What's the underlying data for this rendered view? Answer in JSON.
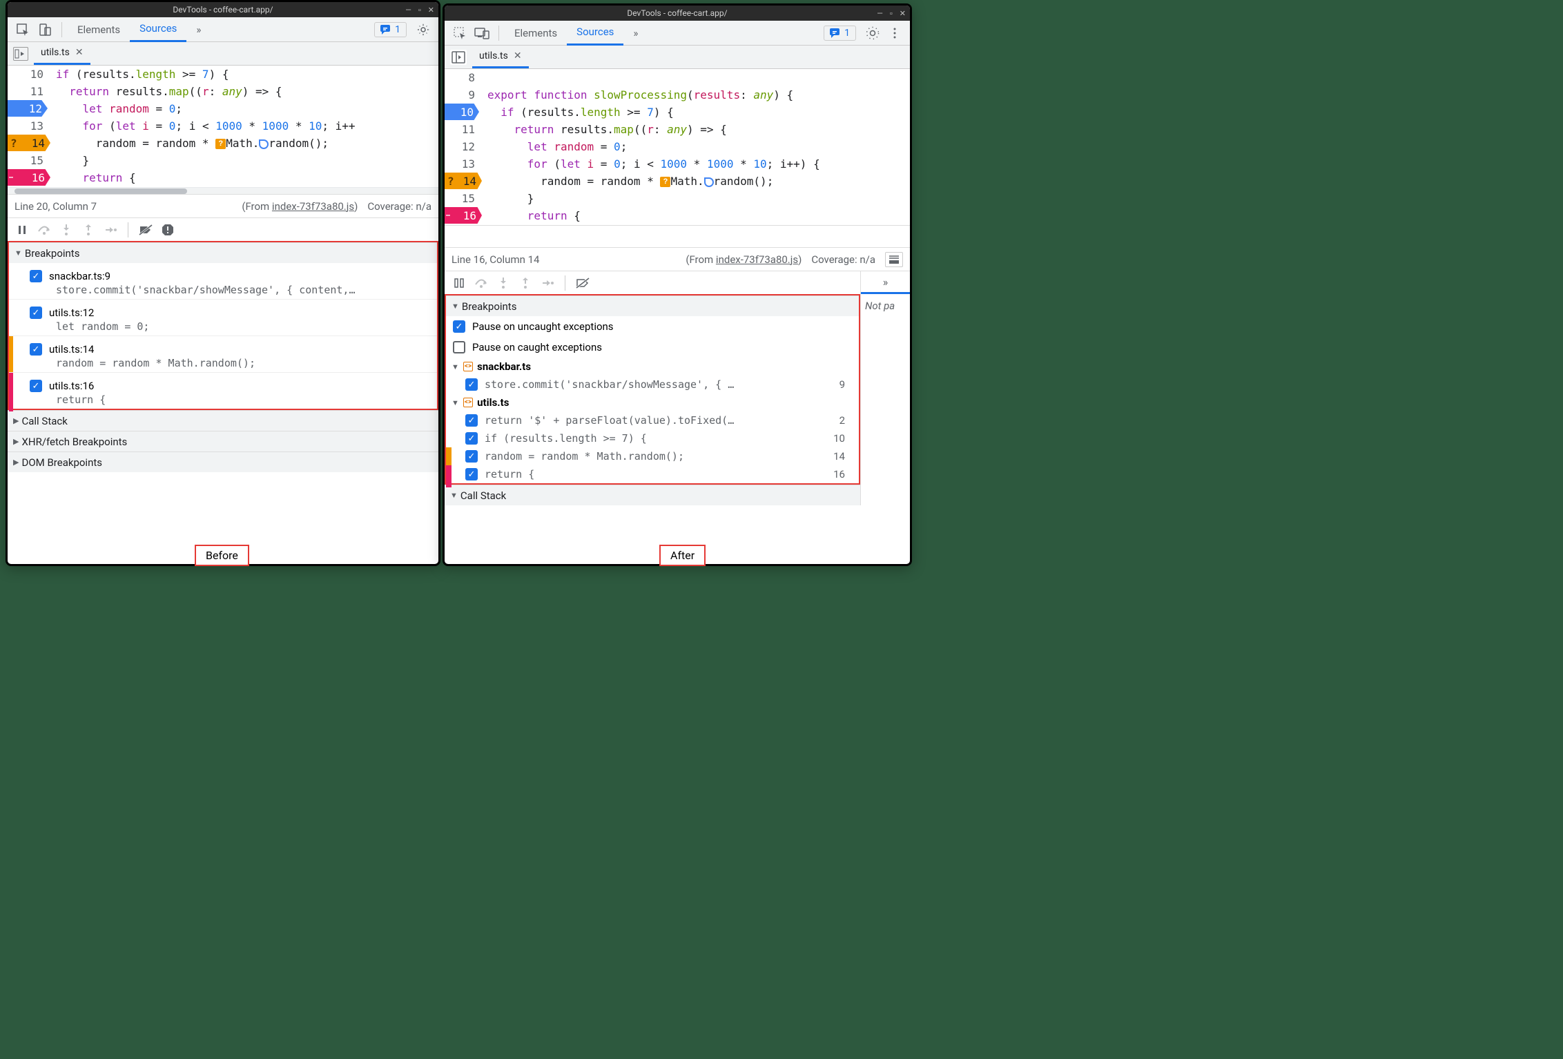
{
  "before": {
    "title": "DevTools - coffee-cart.app/",
    "tabs": {
      "elements": "Elements",
      "sources": "Sources",
      "more": "»"
    },
    "badge_count": "1",
    "file_tab": "utils.ts",
    "gutter": [
      "10",
      "11",
      "12",
      "13",
      "14",
      "15",
      "16"
    ],
    "status": {
      "pos": "Line 20, Column 7",
      "from_prefix": "(From ",
      "from_link": "index-73f73a80.js",
      "from_suffix": ")",
      "coverage": "Coverage: n/a"
    },
    "sections": {
      "breakpoints": "Breakpoints",
      "callstack": "Call Stack",
      "xhr": "XHR/fetch Breakpoints",
      "dom": "DOM Breakpoints"
    },
    "bp_items": [
      {
        "label": "snackbar.ts:9",
        "code": "store.commit('snackbar/showMessage', { content,…"
      },
      {
        "label": "utils.ts:12",
        "code": "let random = 0;"
      },
      {
        "label": "utils.ts:14",
        "code": "random = random * Math.random();"
      },
      {
        "label": "utils.ts:16",
        "code": "return {"
      }
    ]
  },
  "after": {
    "title": "DevTools - coffee-cart.app/",
    "tabs": {
      "elements": "Elements",
      "sources": "Sources",
      "more": "»"
    },
    "badge_count": "1",
    "file_tab": "utils.ts",
    "gutter": [
      "8",
      "9",
      "10",
      "11",
      "12",
      "13",
      "14",
      "15",
      "16"
    ],
    "status": {
      "pos": "Line 16, Column 14",
      "from_prefix": "(From ",
      "from_link": "index-73f73a80.js",
      "from_suffix": ")",
      "coverage": "Coverage: n/a"
    },
    "sections": {
      "breakpoints": "Breakpoints",
      "callstack": "Call Stack"
    },
    "right_text": "Not pa",
    "pause_uncaught": "Pause on uncaught exceptions",
    "pause_caught": "Pause on caught exceptions",
    "groups": [
      {
        "file": "snackbar.ts",
        "items": [
          {
            "code": "store.commit('snackbar/showMessage', { …",
            "line": "9"
          }
        ]
      },
      {
        "file": "utils.ts",
        "items": [
          {
            "code": "return '$' + parseFloat(value).toFixed(…",
            "line": "2"
          },
          {
            "code": "if (results.length >= 7) {",
            "line": "10"
          },
          {
            "code": "random = random * Math.random();",
            "line": "14"
          },
          {
            "code": "return {",
            "line": "16"
          }
        ]
      }
    ]
  },
  "labels": {
    "before": "Before",
    "after": "After"
  }
}
